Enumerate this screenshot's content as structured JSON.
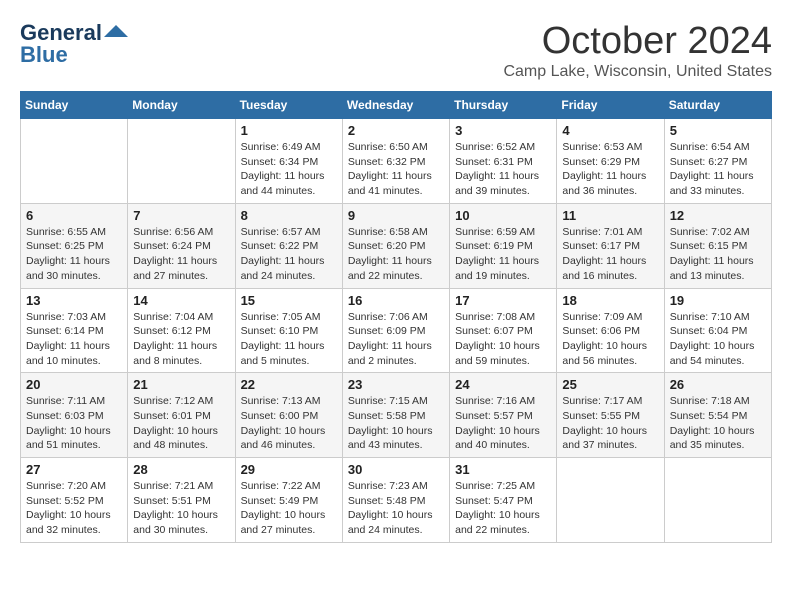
{
  "header": {
    "logo_line1": "General",
    "logo_line2": "Blue",
    "month": "October 2024",
    "location": "Camp Lake, Wisconsin, United States"
  },
  "weekdays": [
    "Sunday",
    "Monday",
    "Tuesday",
    "Wednesday",
    "Thursday",
    "Friday",
    "Saturday"
  ],
  "weeks": [
    [
      {
        "day": "",
        "info": ""
      },
      {
        "day": "",
        "info": ""
      },
      {
        "day": "1",
        "info": "Sunrise: 6:49 AM\nSunset: 6:34 PM\nDaylight: 11 hours and 44 minutes."
      },
      {
        "day": "2",
        "info": "Sunrise: 6:50 AM\nSunset: 6:32 PM\nDaylight: 11 hours and 41 minutes."
      },
      {
        "day": "3",
        "info": "Sunrise: 6:52 AM\nSunset: 6:31 PM\nDaylight: 11 hours and 39 minutes."
      },
      {
        "day": "4",
        "info": "Sunrise: 6:53 AM\nSunset: 6:29 PM\nDaylight: 11 hours and 36 minutes."
      },
      {
        "day": "5",
        "info": "Sunrise: 6:54 AM\nSunset: 6:27 PM\nDaylight: 11 hours and 33 minutes."
      }
    ],
    [
      {
        "day": "6",
        "info": "Sunrise: 6:55 AM\nSunset: 6:25 PM\nDaylight: 11 hours and 30 minutes."
      },
      {
        "day": "7",
        "info": "Sunrise: 6:56 AM\nSunset: 6:24 PM\nDaylight: 11 hours and 27 minutes."
      },
      {
        "day": "8",
        "info": "Sunrise: 6:57 AM\nSunset: 6:22 PM\nDaylight: 11 hours and 24 minutes."
      },
      {
        "day": "9",
        "info": "Sunrise: 6:58 AM\nSunset: 6:20 PM\nDaylight: 11 hours and 22 minutes."
      },
      {
        "day": "10",
        "info": "Sunrise: 6:59 AM\nSunset: 6:19 PM\nDaylight: 11 hours and 19 minutes."
      },
      {
        "day": "11",
        "info": "Sunrise: 7:01 AM\nSunset: 6:17 PM\nDaylight: 11 hours and 16 minutes."
      },
      {
        "day": "12",
        "info": "Sunrise: 7:02 AM\nSunset: 6:15 PM\nDaylight: 11 hours and 13 minutes."
      }
    ],
    [
      {
        "day": "13",
        "info": "Sunrise: 7:03 AM\nSunset: 6:14 PM\nDaylight: 11 hours and 10 minutes."
      },
      {
        "day": "14",
        "info": "Sunrise: 7:04 AM\nSunset: 6:12 PM\nDaylight: 11 hours and 8 minutes."
      },
      {
        "day": "15",
        "info": "Sunrise: 7:05 AM\nSunset: 6:10 PM\nDaylight: 11 hours and 5 minutes."
      },
      {
        "day": "16",
        "info": "Sunrise: 7:06 AM\nSunset: 6:09 PM\nDaylight: 11 hours and 2 minutes."
      },
      {
        "day": "17",
        "info": "Sunrise: 7:08 AM\nSunset: 6:07 PM\nDaylight: 10 hours and 59 minutes."
      },
      {
        "day": "18",
        "info": "Sunrise: 7:09 AM\nSunset: 6:06 PM\nDaylight: 10 hours and 56 minutes."
      },
      {
        "day": "19",
        "info": "Sunrise: 7:10 AM\nSunset: 6:04 PM\nDaylight: 10 hours and 54 minutes."
      }
    ],
    [
      {
        "day": "20",
        "info": "Sunrise: 7:11 AM\nSunset: 6:03 PM\nDaylight: 10 hours and 51 minutes."
      },
      {
        "day": "21",
        "info": "Sunrise: 7:12 AM\nSunset: 6:01 PM\nDaylight: 10 hours and 48 minutes."
      },
      {
        "day": "22",
        "info": "Sunrise: 7:13 AM\nSunset: 6:00 PM\nDaylight: 10 hours and 46 minutes."
      },
      {
        "day": "23",
        "info": "Sunrise: 7:15 AM\nSunset: 5:58 PM\nDaylight: 10 hours and 43 minutes."
      },
      {
        "day": "24",
        "info": "Sunrise: 7:16 AM\nSunset: 5:57 PM\nDaylight: 10 hours and 40 minutes."
      },
      {
        "day": "25",
        "info": "Sunrise: 7:17 AM\nSunset: 5:55 PM\nDaylight: 10 hours and 37 minutes."
      },
      {
        "day": "26",
        "info": "Sunrise: 7:18 AM\nSunset: 5:54 PM\nDaylight: 10 hours and 35 minutes."
      }
    ],
    [
      {
        "day": "27",
        "info": "Sunrise: 7:20 AM\nSunset: 5:52 PM\nDaylight: 10 hours and 32 minutes."
      },
      {
        "day": "28",
        "info": "Sunrise: 7:21 AM\nSunset: 5:51 PM\nDaylight: 10 hours and 30 minutes."
      },
      {
        "day": "29",
        "info": "Sunrise: 7:22 AM\nSunset: 5:49 PM\nDaylight: 10 hours and 27 minutes."
      },
      {
        "day": "30",
        "info": "Sunrise: 7:23 AM\nSunset: 5:48 PM\nDaylight: 10 hours and 24 minutes."
      },
      {
        "day": "31",
        "info": "Sunrise: 7:25 AM\nSunset: 5:47 PM\nDaylight: 10 hours and 22 minutes."
      },
      {
        "day": "",
        "info": ""
      },
      {
        "day": "",
        "info": ""
      }
    ]
  ]
}
